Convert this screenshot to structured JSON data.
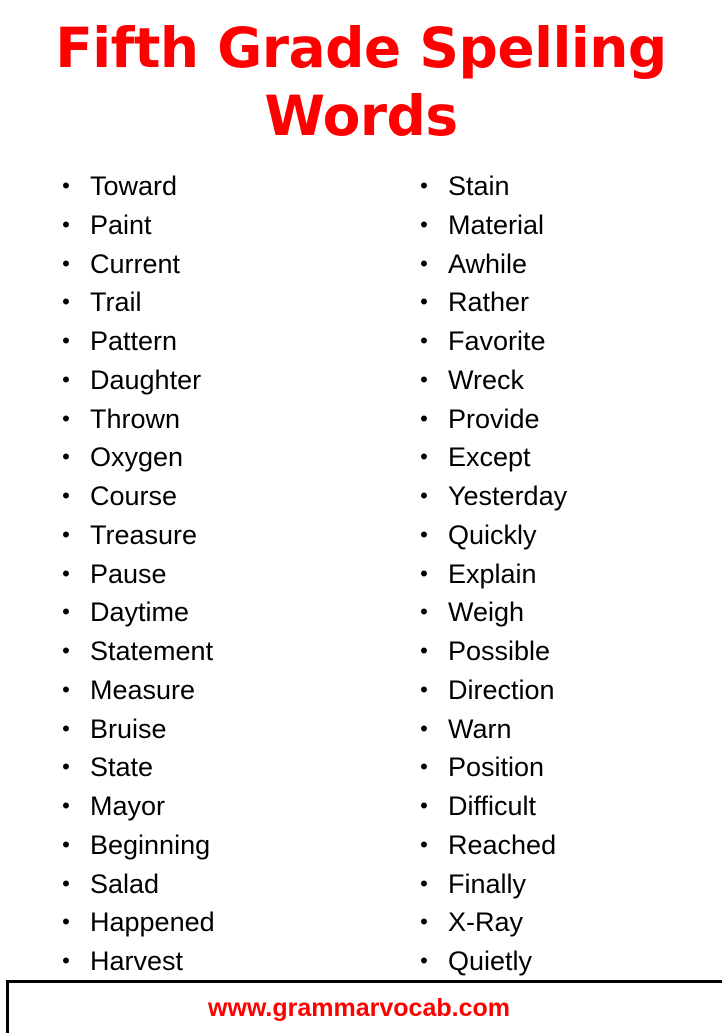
{
  "page": {
    "background_color": "#ffffff",
    "accent_color": "#ff0000",
    "text_color": "#000000"
  },
  "header": {
    "title_line_1": "Fifth Grade Spelling",
    "title_line_2": "Words",
    "title_full": "Fifth Grade Spelling Words"
  },
  "bullet_glyph": "•",
  "columns": {
    "left": {
      "words": [
        "Toward",
        "Paint",
        "Current",
        "Trail",
        "Pattern",
        "Daughter",
        "Thrown",
        "Oxygen",
        "Course",
        "Treasure",
        "Pause",
        "Daytime",
        "Statement",
        "Measure",
        "Bruise",
        "State",
        "Mayor",
        "Beginning",
        "Salad",
        "Happened",
        "Harvest"
      ]
    },
    "right": {
      "words": [
        "Stain",
        "Material",
        "Awhile",
        "Rather",
        "Favorite",
        "Wreck",
        "Provide",
        "Except",
        "Yesterday",
        "Quickly",
        "Explain",
        "Weigh",
        "Possible",
        "Direction",
        "Warn",
        "Position",
        "Difficult",
        "Reached",
        "Finally",
        "X-Ray",
        "Quietly"
      ]
    }
  },
  "footer": {
    "website": "www.grammarvocab.com"
  }
}
